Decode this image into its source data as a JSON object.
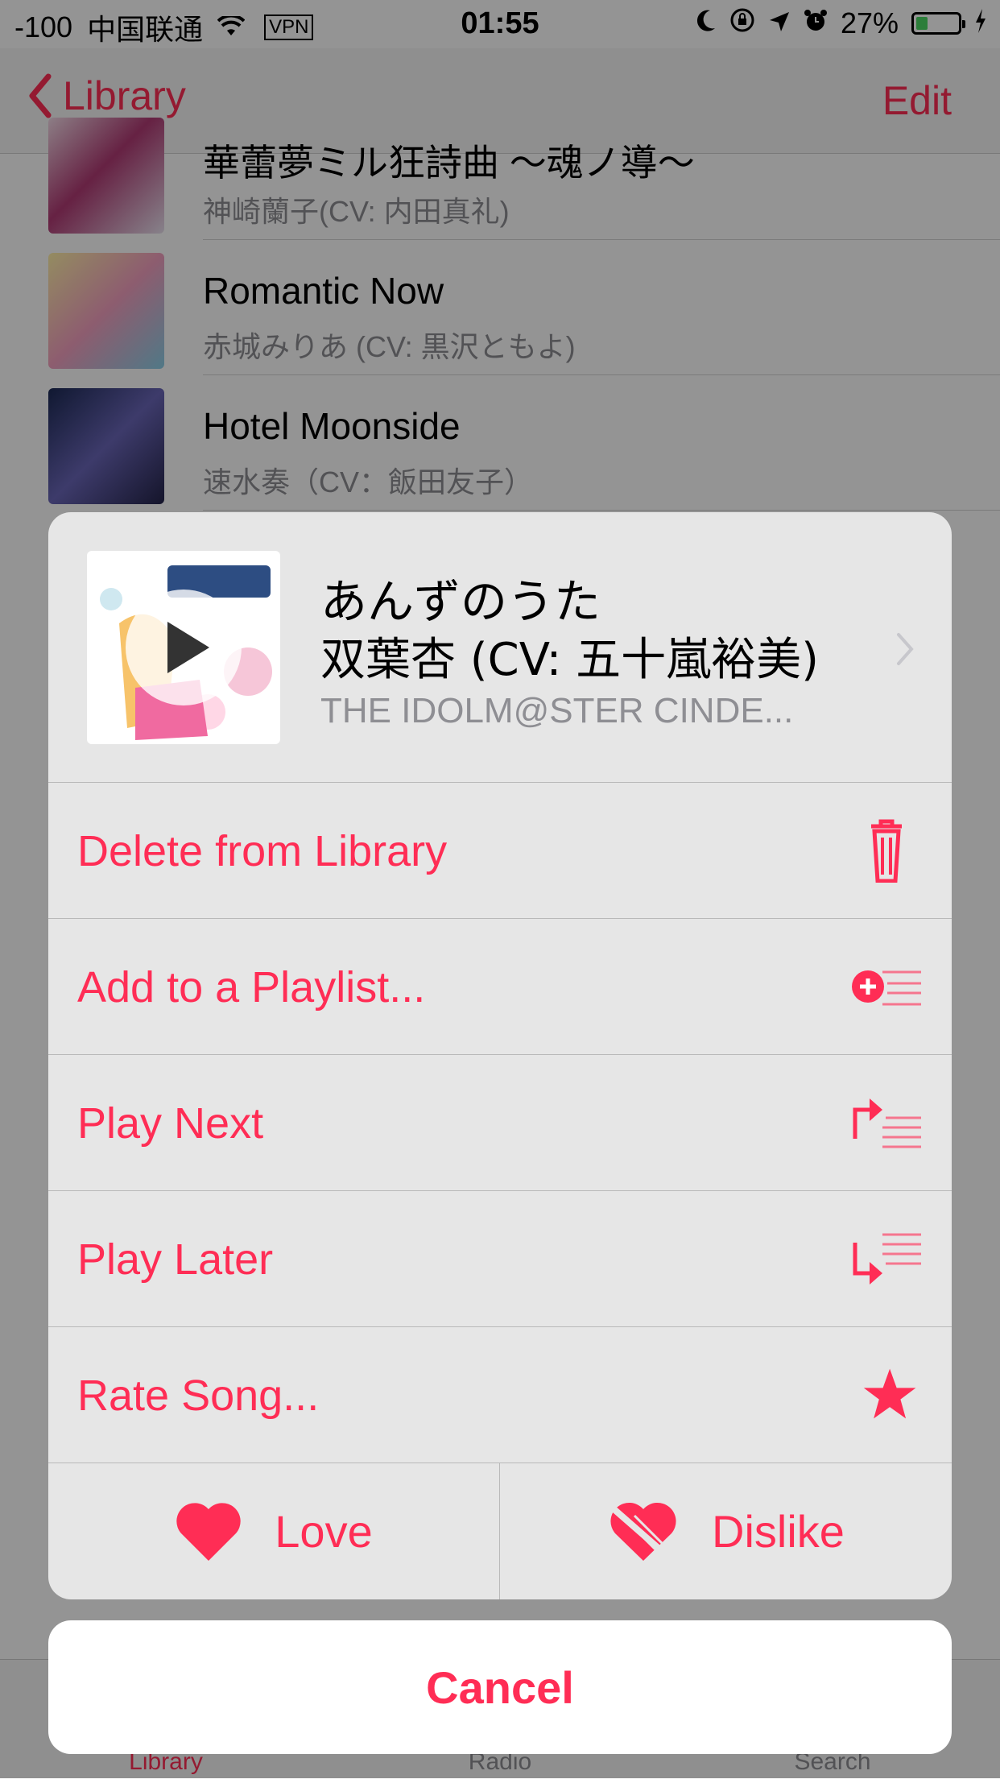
{
  "status_bar": {
    "signal": "-100",
    "carrier": "中国联通",
    "vpn": "VPN",
    "time": "01:55",
    "battery": "27%",
    "battery_level": 0.27
  },
  "nav": {
    "back_label": "Library",
    "edit_label": "Edit"
  },
  "songs": [
    {
      "title": "華蕾夢ミル狂詩曲 ～魂ノ導～",
      "artist": "神崎蘭子(CV: 内田真礼)"
    },
    {
      "title": "Romantic Now",
      "artist": "赤城みりあ (CV: 黒沢ともよ)"
    },
    {
      "title": "Hotel Moonside",
      "artist": "速水奏（CV：飯田友子）"
    }
  ],
  "tabs": [
    {
      "label": "Library",
      "active": true
    },
    {
      "label": "Radio",
      "active": false
    },
    {
      "label": "Search",
      "active": false
    }
  ],
  "sheet": {
    "title": "あんずのうた",
    "artist": "双葉杏 (CV: 五十嵐裕美)",
    "album": "THE IDOLM@STER CINDE...",
    "actions": [
      {
        "label": "Delete from Library",
        "icon": "trash-icon"
      },
      {
        "label": "Add to a Playlist...",
        "icon": "add-to-playlist-icon"
      },
      {
        "label": "Play Next",
        "icon": "play-next-icon"
      },
      {
        "label": "Play Later",
        "icon": "play-later-icon"
      },
      {
        "label": "Rate Song...",
        "icon": "star-icon"
      }
    ],
    "love_label": "Love",
    "dislike_label": "Dislike",
    "cancel_label": "Cancel"
  },
  "colors": {
    "accent": "#ff2d55",
    "secondary_text": "#8e8e93"
  }
}
